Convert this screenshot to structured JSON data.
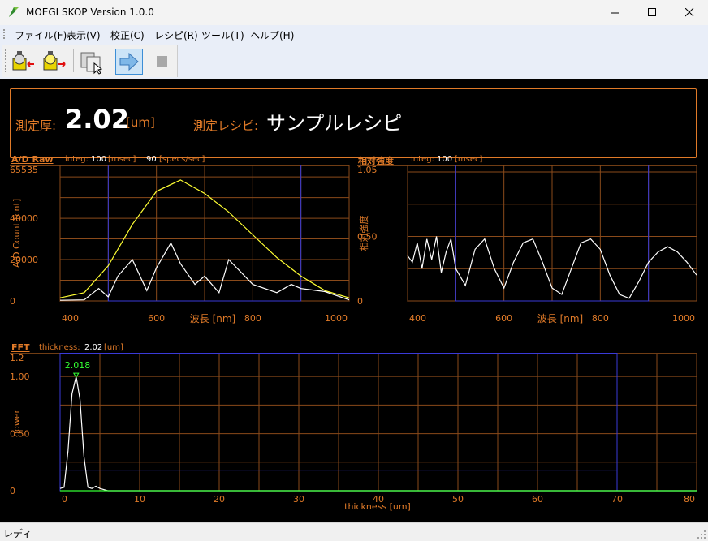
{
  "window": {
    "title": "MOEGI SKOP Version 1.0.0",
    "controls": [
      "minimize",
      "maximize",
      "close"
    ]
  },
  "menu": [
    {
      "label": "ファイル(F)"
    },
    {
      "label": "表示(V)"
    },
    {
      "label": "校正(C)"
    },
    {
      "label": "レシピ(R)"
    },
    {
      "label": "ツール(T)"
    },
    {
      "label": "ヘルプ(H)"
    }
  ],
  "toolbar": {
    "buttons": [
      {
        "icon": "lamp-off-icon"
      },
      {
        "icon": "lamp-on-icon"
      },
      {
        "icon": "copy-window-icon"
      },
      {
        "icon": "arrow-right-icon",
        "active": true
      },
      {
        "icon": "stop-icon"
      }
    ]
  },
  "info": {
    "thickness_label": "測定厚:",
    "thickness_value": "2.02",
    "thickness_unit": "[um]",
    "recipe_label": "測定レシピ:",
    "recipe_value": "サンプルレシピ"
  },
  "colors": {
    "accent": "#e07a28",
    "plot_bg": "#000000",
    "grid": "#8a4a1a",
    "roi": "#3a3ad8",
    "raw_curve": "#ffff33",
    "trace": "#ffffff",
    "peak": "#33ff33"
  },
  "charts": {
    "raw": {
      "title": "A/D Raw",
      "sub_integ_label": "integ:",
      "sub_integ_value": "100",
      "sub_integ_unit": "[msec]",
      "sub_rate_value": "90",
      "sub_rate_unit": "[specs/sec]",
      "ylabel": "A/D Count [cnt]",
      "xlabel": "波長 [nm]",
      "xticks": [
        "400",
        "600",
        "800",
        "1000"
      ],
      "yticks": [
        "0",
        "20000",
        "40000"
      ],
      "ymax_label": "65535"
    },
    "rel": {
      "title": "相対強度",
      "sub_integ_label": "integ:",
      "sub_integ_value": "100",
      "sub_integ_unit": "[msec]",
      "ylabel": "相対強度",
      "xlabel": "波長 [nm]",
      "xticks": [
        "400",
        "600",
        "800",
        "1000"
      ],
      "yticks": [
        "0",
        "0.50"
      ],
      "ymax_label": "1.05"
    },
    "fft": {
      "title": "FFT",
      "sub_label": "thickness:",
      "sub_value": "2.02",
      "sub_unit": "[um]",
      "ylabel": "power",
      "xlabel": "thickness [um]",
      "xticks": [
        "0",
        "10",
        "20",
        "30",
        "40",
        "50",
        "60",
        "70",
        "80"
      ],
      "yticks": [
        "0",
        "0.50",
        "1.00"
      ],
      "ymax_label": "1.2",
      "peak_label": "2.018"
    }
  },
  "chart_data": [
    {
      "type": "line",
      "title": "A/D Raw",
      "xlabel": "波長 [nm]",
      "ylabel": "A/D Count [cnt]",
      "xlim": [
        400,
        1000
      ],
      "ylim": [
        0,
        65535
      ],
      "roi_x": [
        500,
        900
      ],
      "series": [
        {
          "color": "#ffff33",
          "x": [
            400,
            450,
            500,
            550,
            600,
            650,
            700,
            750,
            800,
            850,
            900,
            950,
            1000
          ],
          "y": [
            1500,
            4000,
            17000,
            37000,
            53000,
            58500,
            52000,
            43000,
            32000,
            21000,
            12000,
            5000,
            1500
          ]
        },
        {
          "color": "#ffffff",
          "x": [
            400,
            450,
            480,
            500,
            520,
            550,
            580,
            600,
            630,
            650,
            680,
            700,
            730,
            750,
            800,
            850,
            880,
            900,
            950,
            1000
          ],
          "y": [
            300,
            500,
            6000,
            2000,
            12000,
            20000,
            5000,
            16000,
            28000,
            18000,
            8000,
            12000,
            4000,
            20000,
            8000,
            4000,
            8000,
            6000,
            4500,
            500
          ]
        }
      ]
    },
    {
      "type": "line",
      "title": "相対強度",
      "xlabel": "波長 [nm]",
      "ylabel": "相対強度",
      "xlim": [
        400,
        1000
      ],
      "ylim": [
        0,
        1.05
      ],
      "roi_x": [
        500,
        900
      ],
      "series": [
        {
          "color": "#ffffff",
          "x": [
            400,
            410,
            420,
            430,
            440,
            450,
            460,
            470,
            480,
            490,
            500,
            520,
            540,
            560,
            580,
            600,
            620,
            640,
            660,
            680,
            700,
            720,
            740,
            760,
            780,
            800,
            820,
            840,
            860,
            880,
            900,
            920,
            940,
            960,
            980,
            1000
          ],
          "y": [
            0.35,
            0.3,
            0.45,
            0.25,
            0.48,
            0.32,
            0.5,
            0.22,
            0.38,
            0.48,
            0.25,
            0.12,
            0.4,
            0.48,
            0.25,
            0.1,
            0.3,
            0.45,
            0.48,
            0.3,
            0.1,
            0.05,
            0.25,
            0.45,
            0.48,
            0.4,
            0.2,
            0.05,
            0.02,
            0.15,
            0.3,
            0.38,
            0.42,
            0.38,
            0.3,
            0.2
          ]
        }
      ]
    },
    {
      "type": "line",
      "title": "FFT",
      "xlabel": "thickness [um]",
      "ylabel": "power",
      "xlim": [
        0,
        80
      ],
      "ylim": [
        0,
        1.2
      ],
      "roi_x": [
        0,
        70
      ],
      "threshold_y": 0.18,
      "peak": {
        "x": 2.018,
        "y": 1.0
      },
      "series": [
        {
          "color": "#ffffff",
          "x": [
            0,
            0.5,
            1,
            1.5,
            2.02,
            2.5,
            3,
            3.5,
            4,
            4.5,
            5,
            6,
            80
          ],
          "y": [
            0.02,
            0.03,
            0.35,
            0.85,
            1.0,
            0.8,
            0.3,
            0.03,
            0.02,
            0.04,
            0.02,
            0.0,
            0.0
          ]
        },
        {
          "color": "#33ff33",
          "x": [
            0,
            80
          ],
          "y": [
            0.0,
            0.0
          ]
        }
      ]
    }
  ]
}
